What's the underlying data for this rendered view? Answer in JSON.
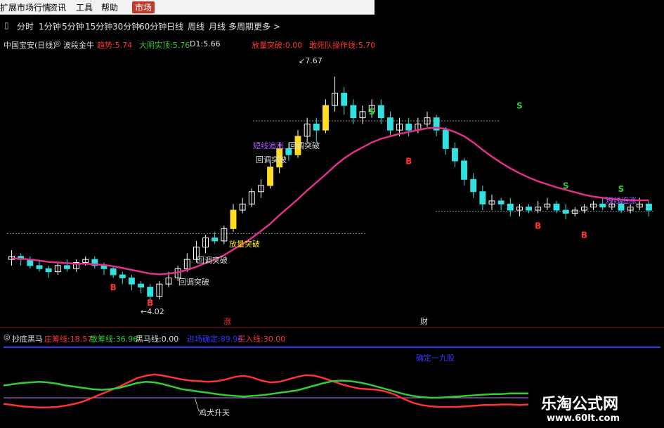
{
  "menu": {
    "items": [
      "扩展市场行情",
      "资讯",
      "工具",
      "帮助"
    ],
    "active": "市场"
  },
  "periods": [
    "分时",
    "1分钟",
    "5分钟",
    "15分钟",
    "30分钟",
    "60分钟",
    "日线",
    "周线",
    "月线",
    "多周期",
    "更多 >"
  ],
  "upper": {
    "stock": "中国宝安(日线)",
    "indicator": "波段金牛",
    "items": [
      {
        "label": "趋势:",
        "value": "5.74",
        "color": "#ff3333"
      },
      {
        "label": "大阴实顶:",
        "value": "5.76",
        "color": "#33cc33"
      },
      {
        "label": "D1:",
        "value": "5.66",
        "color": "#cccccc"
      },
      {
        "label": "放量突破:",
        "value": "0.00",
        "color": "#ff3333"
      },
      {
        "label": "敢死队操作线:",
        "value": "5.70",
        "color": "#ff3333"
      }
    ],
    "high_label": "7.67",
    "low_label": "4.02",
    "date_marks": [
      "涨",
      "财"
    ],
    "annotations": [
      "短线追涨",
      "回调突破",
      "放量突破",
      "回调突破",
      "回调突破",
      "短线追涨"
    ],
    "signals": {
      "buy": "B",
      "sell": "S"
    }
  },
  "lower": {
    "indicator": "抄底黑马",
    "items": [
      {
        "label": "庄筹线:",
        "value": "18.57",
        "color": "#ff3333"
      },
      {
        "label": "散筹线:",
        "value": "36.96",
        "color": "#33cc33"
      },
      {
        "label": "黑马线:",
        "value": "0.00",
        "color": "#cccccc"
      },
      {
        "label": "进场确定:",
        "value": "89.96",
        "color": "#3333ff"
      },
      {
        "label": "买入线:",
        "value": "30.00",
        "color": "#ff3333"
      }
    ],
    "annotation_1": "鸡犬升天",
    "annotation_2": "确定一九股"
  },
  "watermark": {
    "line1": "乐淘公式网",
    "line2": "www.60lt.com"
  },
  "colors": {
    "up": "#ffffff",
    "down": "#33e0e0",
    "ma": "#e0308a",
    "red": "#ff3333",
    "green": "#33cc33",
    "yellow": "#ffdd22",
    "blue": "#3333ff"
  },
  "chart_data": [
    {
      "type": "candlestick",
      "ylim": [
        3.8,
        8.0
      ],
      "candles": [
        [
          4.7,
          4.75,
          4.85,
          4.6
        ],
        [
          4.75,
          4.7,
          4.8,
          4.6
        ],
        [
          4.7,
          4.6,
          4.75,
          4.55
        ],
        [
          4.6,
          4.55,
          4.7,
          4.5
        ],
        [
          4.55,
          4.5,
          4.6,
          4.4
        ],
        [
          4.5,
          4.6,
          4.65,
          4.45
        ],
        [
          4.6,
          4.55,
          4.7,
          4.5
        ],
        [
          4.55,
          4.65,
          4.7,
          4.5
        ],
        [
          4.65,
          4.7,
          4.75,
          4.6
        ],
        [
          4.7,
          4.6,
          4.75,
          4.55
        ],
        [
          4.6,
          4.55,
          4.65,
          4.45
        ],
        [
          4.55,
          4.45,
          4.6,
          4.4
        ],
        [
          4.45,
          4.4,
          4.5,
          4.3
        ],
        [
          4.4,
          4.3,
          4.45,
          4.2
        ],
        [
          4.3,
          4.25,
          4.35,
          4.15
        ],
        [
          4.25,
          4.1,
          4.3,
          4.02
        ],
        [
          4.1,
          4.3,
          4.35,
          4.05
        ],
        [
          4.3,
          4.4,
          4.5,
          4.25
        ],
        [
          4.4,
          4.55,
          4.6,
          4.35
        ],
        [
          4.55,
          4.7,
          4.8,
          4.5
        ],
        [
          4.7,
          4.9,
          5.0,
          4.65
        ],
        [
          4.9,
          5.05,
          5.1,
          4.8
        ],
        [
          5.05,
          5.0,
          5.15,
          4.95
        ],
        [
          5.0,
          5.2,
          5.25,
          4.95
        ],
        [
          5.2,
          5.5,
          5.6,
          5.15
        ],
        [
          5.5,
          5.6,
          5.7,
          5.45
        ],
        [
          5.6,
          5.8,
          5.85,
          5.55
        ],
        [
          5.8,
          5.9,
          6.0,
          5.7
        ],
        [
          5.9,
          6.2,
          6.3,
          5.85
        ],
        [
          6.2,
          6.5,
          6.6,
          6.1
        ],
        [
          6.5,
          6.4,
          6.6,
          6.3
        ],
        [
          6.4,
          6.7,
          6.8,
          6.35
        ],
        [
          6.7,
          6.9,
          7.0,
          6.6
        ],
        [
          6.9,
          6.8,
          7.0,
          6.6
        ],
        [
          6.8,
          7.2,
          7.3,
          6.75
        ],
        [
          7.2,
          7.4,
          7.67,
          7.1
        ],
        [
          7.4,
          7.2,
          7.5,
          7.05
        ],
        [
          7.2,
          7.0,
          7.3,
          6.9
        ],
        [
          7.0,
          7.1,
          7.2,
          6.9
        ],
        [
          7.1,
          7.2,
          7.3,
          7.0
        ],
        [
          7.2,
          7.0,
          7.3,
          6.9
        ],
        [
          7.0,
          6.8,
          7.1,
          6.7
        ],
        [
          6.8,
          6.9,
          7.0,
          6.7
        ],
        [
          6.9,
          6.8,
          7.0,
          6.7
        ],
        [
          6.8,
          6.9,
          7.0,
          6.75
        ],
        [
          6.9,
          7.0,
          7.1,
          6.85
        ],
        [
          7.0,
          6.8,
          7.05,
          6.7
        ],
        [
          6.8,
          6.5,
          6.85,
          6.4
        ],
        [
          6.5,
          6.3,
          6.6,
          6.2
        ],
        [
          6.3,
          6.0,
          6.35,
          5.9
        ],
        [
          6.0,
          5.8,
          6.1,
          5.7
        ],
        [
          5.8,
          5.6,
          5.9,
          5.5
        ],
        [
          5.6,
          5.65,
          5.75,
          5.5
        ],
        [
          5.65,
          5.6,
          5.7,
          5.5
        ],
        [
          5.6,
          5.5,
          5.7,
          5.4
        ],
        [
          5.5,
          5.55,
          5.6,
          5.4
        ],
        [
          5.55,
          5.5,
          5.6,
          5.45
        ],
        [
          5.5,
          5.55,
          5.65,
          5.45
        ],
        [
          5.55,
          5.6,
          5.7,
          5.5
        ],
        [
          5.6,
          5.5,
          5.65,
          5.45
        ],
        [
          5.5,
          5.45,
          5.6,
          5.35
        ],
        [
          5.45,
          5.5,
          5.55,
          5.4
        ],
        [
          5.5,
          5.55,
          5.6,
          5.45
        ],
        [
          5.55,
          5.6,
          5.65,
          5.5
        ],
        [
          5.6,
          5.55,
          5.7,
          5.5
        ],
        [
          5.55,
          5.6,
          5.65,
          5.5
        ],
        [
          5.6,
          5.5,
          5.65,
          5.45
        ],
        [
          5.5,
          5.55,
          5.6,
          5.45
        ],
        [
          5.55,
          5.6,
          5.7,
          5.5
        ],
        [
          5.6,
          5.5,
          5.65,
          5.4
        ]
      ],
      "ma": [
        4.72,
        4.71,
        4.7,
        4.68,
        4.66,
        4.65,
        4.64,
        4.63,
        4.63,
        4.62,
        4.61,
        4.59,
        4.56,
        4.53,
        4.5,
        4.47,
        4.46,
        4.47,
        4.49,
        4.53,
        4.58,
        4.64,
        4.7,
        4.77,
        4.86,
        4.95,
        5.05,
        5.16,
        5.28,
        5.42,
        5.55,
        5.68,
        5.82,
        5.95,
        6.08,
        6.22,
        6.34,
        6.44,
        6.52,
        6.6,
        6.66,
        6.7,
        6.74,
        6.77,
        6.8,
        6.83,
        6.84,
        6.82,
        6.77,
        6.7,
        6.6,
        6.48,
        6.37,
        6.27,
        6.18,
        6.1,
        6.03,
        5.97,
        5.92,
        5.87,
        5.83,
        5.79,
        5.75,
        5.72,
        5.7,
        5.68,
        5.67,
        5.66,
        5.66,
        5.66
      ],
      "hlines": [
        5.12,
        6.95,
        5.48
      ]
    },
    {
      "type": "line",
      "ylim": [
        0,
        100
      ],
      "series": [
        {
          "name": "庄筹线",
          "values": [
            20,
            18,
            16,
            15,
            14,
            14,
            15,
            17,
            20,
            24,
            30,
            36,
            42,
            48,
            55,
            62,
            66,
            68,
            66,
            63,
            60,
            58,
            57,
            56,
            57,
            60,
            64,
            66,
            63,
            58,
            55,
            56,
            60,
            64,
            67,
            66,
            62,
            57,
            52,
            48,
            45,
            44,
            43,
            40,
            35,
            28,
            22,
            18,
            16,
            15,
            15,
            15,
            16,
            17,
            18,
            18,
            19,
            19,
            18,
            19
          ]
        },
        {
          "name": "散筹线",
          "values": [
            50,
            52,
            54,
            55,
            56,
            55,
            53,
            50,
            48,
            46,
            44,
            43,
            44,
            46,
            50,
            54,
            56,
            55,
            52,
            48,
            44,
            42,
            40,
            38,
            36,
            34,
            33,
            32,
            33,
            34,
            36,
            38,
            40,
            42,
            46,
            50,
            54,
            57,
            58,
            57,
            55,
            52,
            48,
            44,
            40,
            36,
            33,
            31,
            30,
            30,
            31,
            32,
            33,
            34,
            35,
            36,
            36,
            37,
            37,
            37
          ]
        }
      ]
    }
  ]
}
